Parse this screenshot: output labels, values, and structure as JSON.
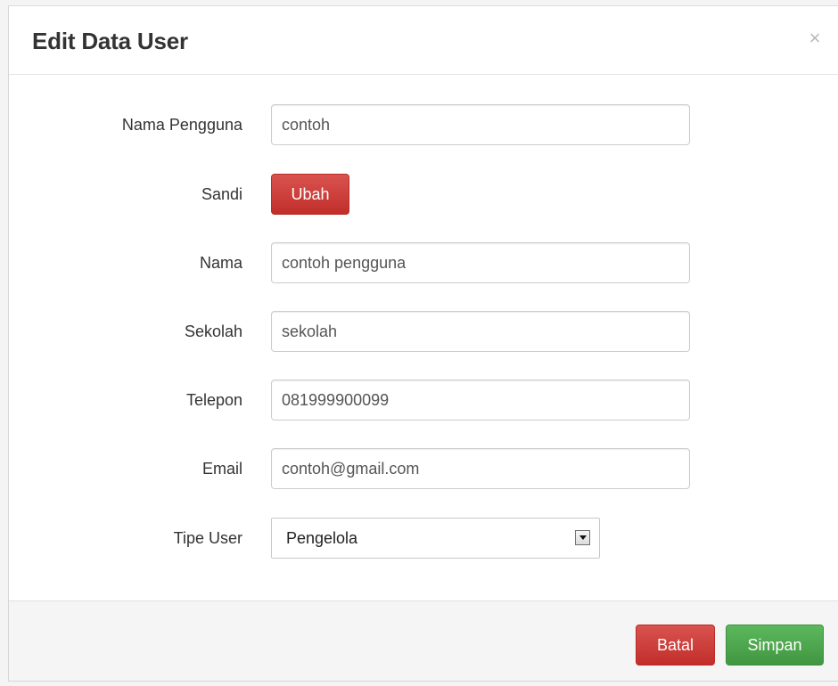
{
  "modal": {
    "title": "Edit Data User",
    "close_symbol": "×"
  },
  "form": {
    "username": {
      "label": "Nama Pengguna",
      "value": "contoh"
    },
    "password": {
      "label": "Sandi",
      "button_label": "Ubah"
    },
    "name": {
      "label": "Nama",
      "value": "contoh pengguna"
    },
    "school": {
      "label": "Sekolah",
      "value": "sekolah"
    },
    "phone": {
      "label": "Telepon",
      "value": "081999900099"
    },
    "email": {
      "label": "Email",
      "value": "contoh@gmail.com"
    },
    "user_type": {
      "label": "Tipe User",
      "selected": "Pengelola"
    }
  },
  "footer": {
    "cancel_label": "Batal",
    "save_label": "Simpan"
  },
  "colors": {
    "danger": "#d9534f",
    "success": "#5cb85c"
  },
  "icons": {
    "close": "close-icon",
    "dropdown": "chevron-down-icon"
  }
}
